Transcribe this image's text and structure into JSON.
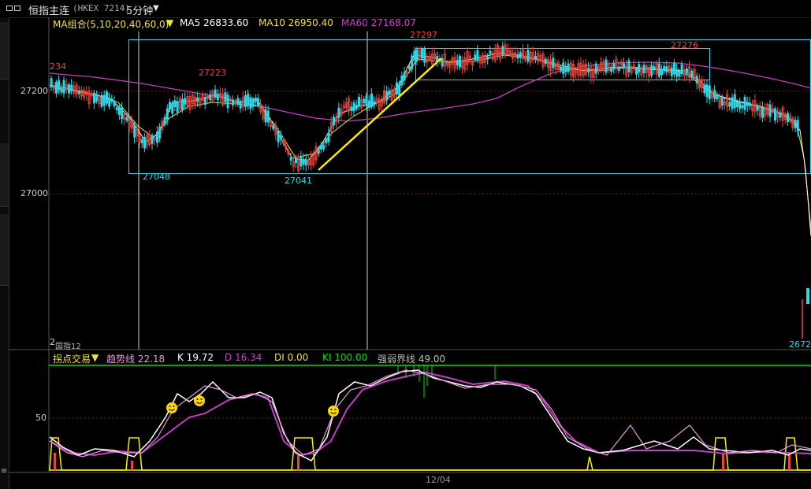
{
  "title": {
    "name": "恒指主连",
    "code": "(HKEX 7214)",
    "period": "5分钟"
  },
  "ma_legend": {
    "group": "MA组合(5,10,20,40,60,0)",
    "ma5": "MA5 26833.60",
    "ma10": "MA10 26950.40",
    "ma60": "MA60 27168.07"
  },
  "price_axis": {
    "upper": "27200",
    "lower": "27000"
  },
  "price_labels": {
    "left_edge": "234",
    "high_a": "27223",
    "high_b": "27297",
    "high_c": "27276",
    "low_a": "27048",
    "low_b": "27041",
    "last": "2672",
    "bottom_left_a": "2",
    "bottom_left_b": "国指12"
  },
  "indicator_legend": {
    "name": "拐点交易",
    "trend": "趋势线 22.18",
    "k": "K 19.72",
    "d": "D 16.34",
    "di": "DI 0.00",
    "ki": "KI 100.00",
    "boundary": "强弱界线 49.00"
  },
  "indicator_axis": {
    "mid": "50"
  },
  "date_label": "12/04",
  "colors": {
    "up": "#e8453c",
    "down": "#2fd6e6",
    "ma5": "#ffffff",
    "ma10": "#f0e040",
    "ma60": "#c040c0",
    "box": "#2fd6e6",
    "trendline": "#ffea00",
    "indicator_line": "#00e000"
  }
}
